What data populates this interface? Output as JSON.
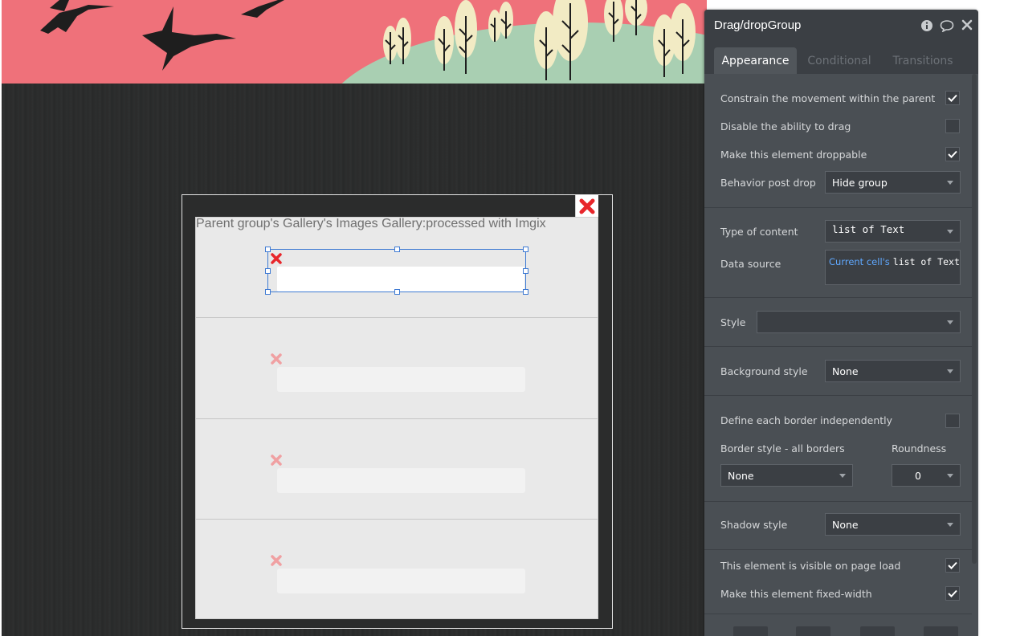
{
  "editor": {
    "title": "Drag/dropGroup",
    "tabs": [
      {
        "label": "Appearance",
        "active": true
      },
      {
        "label": "Conditional",
        "active": false
      },
      {
        "label": "Transitions",
        "active": false
      }
    ],
    "checks": {
      "constrain_movement": {
        "label": "Constrain the movement within the parent",
        "checked": true
      },
      "disable_drag": {
        "label": "Disable the ability to drag",
        "checked": false
      },
      "droppable": {
        "label": "Make this element droppable",
        "checked": true
      }
    },
    "behavior_post_drop": {
      "label": "Behavior post drop",
      "value": "Hide group"
    },
    "type_of_content": {
      "label": "Type of content",
      "value": "list of Text"
    },
    "data_source": {
      "label": "Data source",
      "link": "Current cell's",
      "type": "list of Text"
    },
    "style": {
      "label": "Style",
      "value": ""
    },
    "background_style": {
      "label": "Background style",
      "value": "None"
    },
    "border_independent": {
      "label": "Define each border independently",
      "checked": false
    },
    "border_style": {
      "label": "Border style - all borders",
      "value": "None"
    },
    "roundness": {
      "label": "Roundness",
      "value": "0"
    },
    "shadow_style": {
      "label": "Shadow style",
      "value": "None"
    },
    "visible_on_load": {
      "label": "This element is visible on page load",
      "checked": true
    },
    "fixed_width": {
      "label": "Make this element fixed-width",
      "checked": true
    }
  },
  "canvas": {
    "popup_title": "Parent group's Gallery's Images Gallery:processed with Imgix",
    "cells": 4
  },
  "colors": {
    "banner": "#ef717a",
    "editor_bg": "#4a4f54",
    "selection": "#3e7ad3",
    "delete_x": "#e8262b",
    "link": "#5fa8ff"
  }
}
